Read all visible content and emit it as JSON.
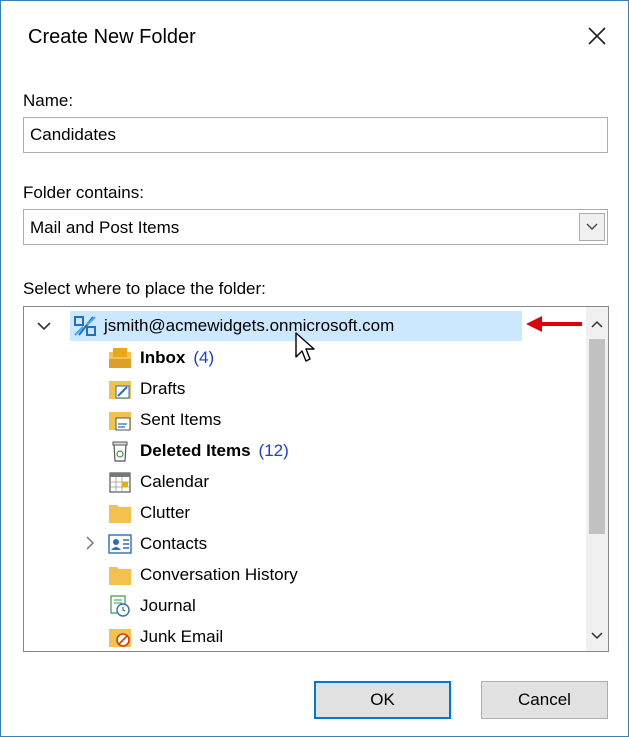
{
  "dialog": {
    "title": "Create New Folder",
    "close_icon": "close-icon"
  },
  "name_field": {
    "label": "Name:",
    "value": "Candidates"
  },
  "folder_contains": {
    "label": "Folder contains:",
    "value": "Mail and Post Items"
  },
  "location": {
    "label": "Select where to place the folder:",
    "account": "jsmith@acmewidgets.onmicrosoft.com",
    "folders": [
      {
        "name": "Inbox",
        "count": "(4)",
        "bold": true,
        "icon": "inbox-icon"
      },
      {
        "name": "Drafts",
        "count": "",
        "bold": false,
        "icon": "drafts-icon"
      },
      {
        "name": "Sent Items",
        "count": "",
        "bold": false,
        "icon": "sent-items-icon"
      },
      {
        "name": "Deleted Items",
        "count": "(12)",
        "bold": true,
        "icon": "trash-icon"
      },
      {
        "name": "Calendar",
        "count": "",
        "bold": false,
        "icon": "calendar-icon"
      },
      {
        "name": "Clutter",
        "count": "",
        "bold": false,
        "icon": "folder-icon"
      },
      {
        "name": "Contacts",
        "count": "",
        "bold": false,
        "icon": "contacts-icon"
      },
      {
        "name": "Conversation History",
        "count": "",
        "bold": false,
        "icon": "folder-icon"
      },
      {
        "name": "Journal",
        "count": "",
        "bold": false,
        "icon": "journal-icon"
      },
      {
        "name": "Junk Email",
        "count": "",
        "bold": false,
        "icon": "junk-email-icon"
      }
    ]
  },
  "buttons": {
    "ok": "OK",
    "cancel": "Cancel"
  },
  "colors": {
    "selection": "#cce8ff",
    "accent": "#0078d7",
    "count": "#1a3fd6",
    "annotation_arrow": "#e0000b"
  }
}
